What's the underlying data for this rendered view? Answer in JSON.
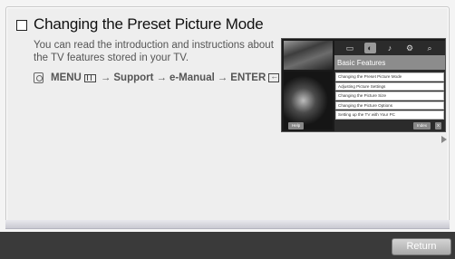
{
  "title": "Changing the Preset Picture Mode",
  "intro": [
    "You can read the introduction and instructions about",
    "the TV features stored in your TV."
  ],
  "path": {
    "menu": "MENU",
    "arrow": "→",
    "support": "Support",
    "emanual": "e-Manual",
    "enter": "ENTER"
  },
  "tv_screen": {
    "heading": "Basic Features",
    "icons": [
      "tv-icon",
      "picture-icon",
      "sound-icon",
      "setup-icon",
      "search-icon"
    ],
    "items": [
      "Changing the Preset Picture Mode",
      "Adjusting Picture Settings",
      "Changing the Picture Size",
      "Changing the Picture Options",
      "Setting up the TV with Your PC"
    ],
    "help_label": "Help",
    "index_label": "Index",
    "close_label": "X"
  },
  "return_label": "Return"
}
